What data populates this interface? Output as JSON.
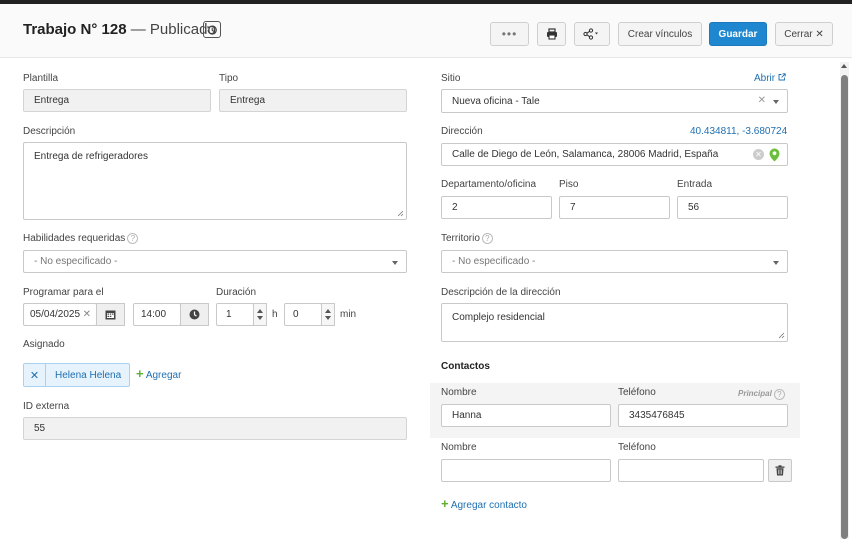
{
  "header": {
    "title_prefix": "Trabajo N°",
    "job_number": "128",
    "status": "— Publicado",
    "more_label": "•••",
    "link_label": "Crear vínculos",
    "save_label": "Guardar",
    "close_label": "Cerrar ✕"
  },
  "left": {
    "template_label": "Plantilla",
    "template_value": "Entrega",
    "type_label": "Tipo",
    "type_value": "Entrega",
    "description_label": "Descripción",
    "description_value": "Entrega de refrigeradores",
    "skills_label": "Habilidades requeridas",
    "skills_value": "- No especificado -",
    "schedule_label": "Programar para el",
    "schedule_date": "05/04/2025",
    "schedule_time": "14:00",
    "duration_label": "Duración",
    "duration_hours": "1",
    "hours_unit": "h",
    "duration_minutes": "0",
    "minutes_unit": "min",
    "assigned_label": "Asignado",
    "assignee": "Helena Helena",
    "add_label": "Agregar",
    "external_id_label": "ID externa",
    "external_id_value": "55"
  },
  "right": {
    "site_label": "Sitio",
    "open_label": "Abrir",
    "site_value": "Nueva oficina - Tale",
    "address_label": "Dirección",
    "coordinates": "40.434811, -3.680724",
    "address_value": "Calle de Diego de León, Salamanca, 28006 Madrid, España",
    "department_label": "Departamento/oficina",
    "department_value": "2",
    "floor_label": "Piso",
    "floor_value": "7",
    "entrance_label": "Entrada",
    "entrance_value": "56",
    "territory_label": "Territorio",
    "territory_value": "- No especificado -",
    "address_desc_label": "Descripción de la dirección",
    "address_desc_value": "Complejo residencial",
    "contacts_title": "Contactos",
    "contacts": [
      {
        "name_label": "Nombre",
        "phone_label": "Teléfono",
        "name": "Hanna",
        "phone": "3435476845",
        "principal_label": "Principal"
      },
      {
        "name_label": "Nombre",
        "phone_label": "Teléfono",
        "name": "",
        "phone": ""
      }
    ],
    "add_contact_label": "Agregar contacto"
  },
  "colors": {
    "primary": "#1f87d0",
    "link": "#1f6fb2",
    "add_green": "#5cb030",
    "pin_green": "#6abf3a"
  },
  "icons": [
    "history-icon",
    "print-icon",
    "share-icon",
    "external-link-icon",
    "calendar-icon",
    "clock-icon",
    "map-pin-icon",
    "trash-icon",
    "help-icon",
    "plus-icon"
  ]
}
